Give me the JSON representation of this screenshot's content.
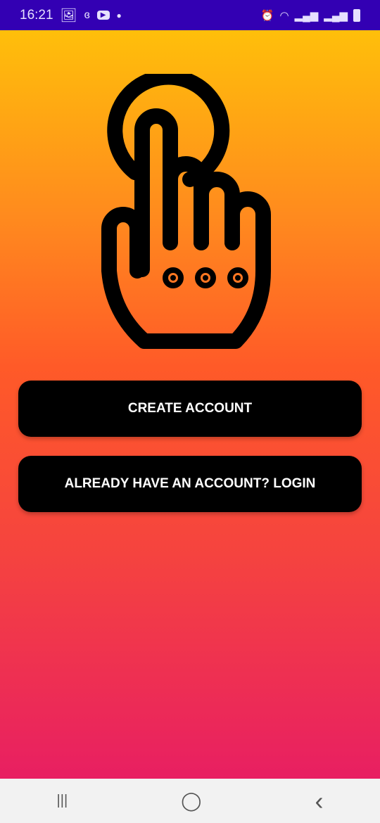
{
  "status_bar": {
    "time": "16:21",
    "icons": [
      "gallery-icon",
      "link-icon",
      "youtube-icon",
      "dot-icon",
      "alarm-icon",
      "wifi-icon",
      "signal-icon",
      "signal-icon",
      "battery-icon"
    ]
  },
  "main": {
    "logo": "tap-hand-icon",
    "create_account": "CREATE ACCOUNT",
    "login": "ALREADY HAVE AN ACCOUNT? LOGIN"
  },
  "nav": {
    "recents": "|||",
    "home": "◯",
    "back": "‹"
  }
}
